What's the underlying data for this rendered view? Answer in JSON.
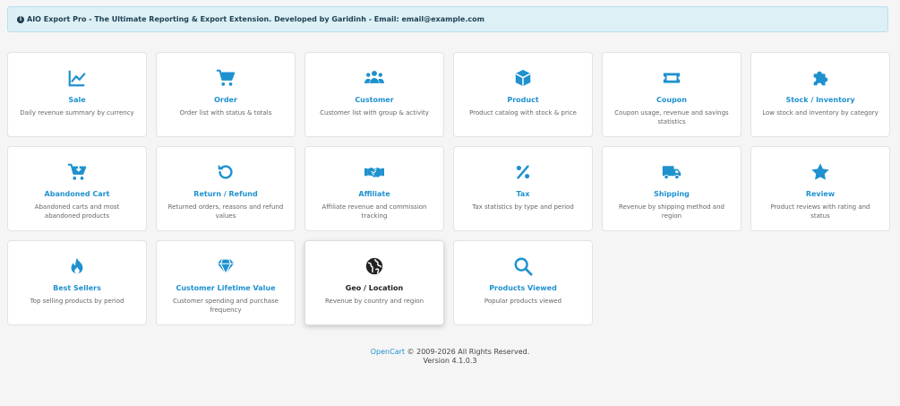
{
  "alert": {
    "text": "AIO Export Pro - The Ultimate Reporting & Export Extension. Developed by Garidinh - Email: email@example.com"
  },
  "colors": {
    "accent": "#1e91cf",
    "active_icon": "#222222"
  },
  "cards": [
    {
      "title": "Sale",
      "desc": "Daily revenue summary by currency",
      "icon": "chart-line-icon"
    },
    {
      "title": "Order",
      "desc": "Order list with status & totals",
      "icon": "shopping-cart-icon"
    },
    {
      "title": "Customer",
      "desc": "Customer list with group & activity",
      "icon": "users-icon"
    },
    {
      "title": "Product",
      "desc": "Product catalog with stock & price",
      "icon": "cube-icon"
    },
    {
      "title": "Coupon",
      "desc": "Coupon usage, revenue and savings statistics",
      "icon": "ticket-icon"
    },
    {
      "title": "Stock / Inventory",
      "desc": "Low stock and inventory by category",
      "icon": "puzzle-icon"
    },
    {
      "title": "Abandoned Cart",
      "desc": "Abandoned carts and most abandoned products",
      "icon": "cart-arrow-down-icon"
    },
    {
      "title": "Return / Refund",
      "desc": "Returned orders, reasons and refund values",
      "icon": "rotate-left-icon"
    },
    {
      "title": "Affiliate",
      "desc": "Affiliate revenue and commission tracking",
      "icon": "handshake-icon"
    },
    {
      "title": "Tax",
      "desc": "Tax statistics by type and period",
      "icon": "percent-icon"
    },
    {
      "title": "Shipping",
      "desc": "Revenue by shipping method and region",
      "icon": "truck-icon"
    },
    {
      "title": "Review",
      "desc": "Product reviews with rating and status",
      "icon": "star-icon"
    },
    {
      "title": "Best Sellers",
      "desc": "Top selling products by period",
      "icon": "fire-icon"
    },
    {
      "title": "Customer Lifetime Value",
      "desc": "Customer spending and purchase frequency",
      "icon": "gem-icon"
    },
    {
      "title": "Geo / Location",
      "desc": "Revenue by country and region",
      "icon": "globe-icon"
    },
    {
      "title": "Products Viewed",
      "desc": "Popular products viewed",
      "icon": "search-icon"
    }
  ],
  "footer": {
    "link": "OpenCart",
    "copyright": " © 2009-2026 All Rights Reserved.",
    "version": "Version 4.1.0.3"
  }
}
